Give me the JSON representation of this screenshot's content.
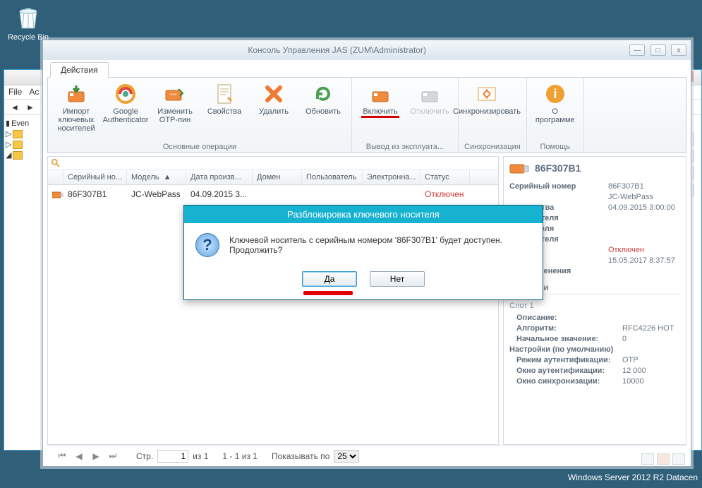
{
  "desktop": {
    "recycle_bin": "Recycle Bin"
  },
  "back_window": {
    "menu": [
      "File",
      "Ac"
    ],
    "tree_root": "Even",
    "close_x": "x"
  },
  "jas": {
    "title": "Консоль Управления JAS (ZUM\\Administrator)",
    "win_buttons": {
      "min": "—",
      "max": "□",
      "close": "x"
    },
    "tab": "Действия",
    "ribbon": {
      "groups": [
        {
          "label": "Основные операции",
          "items": [
            {
              "id": "import",
              "label": "Импорт ключевых\nносителей"
            },
            {
              "id": "gauth",
              "label": "Google\nAuthenticator"
            },
            {
              "id": "otp",
              "label": "Изменить\nOTP-пин"
            },
            {
              "id": "props",
              "label": "Свойства"
            },
            {
              "id": "delete",
              "label": "Удалить"
            },
            {
              "id": "refresh",
              "label": "Обновить"
            }
          ]
        },
        {
          "label": "Вывод из эксплуата...",
          "items": [
            {
              "id": "enable",
              "label": "Включить",
              "underline": true
            },
            {
              "id": "disable",
              "label": "Отключить",
              "disabled": true
            }
          ]
        },
        {
          "label": "Синхронизация",
          "items": [
            {
              "id": "sync",
              "label": "Синхронизировать"
            }
          ]
        },
        {
          "label": "Помощь",
          "items": [
            {
              "id": "about",
              "label": "О программе"
            }
          ]
        }
      ]
    },
    "table": {
      "columns": [
        "Серийный но...",
        "Модель",
        "Дата произв...",
        "Домен",
        "Пользователь",
        "Электронна...",
        "Статус"
      ],
      "widths": [
        90,
        84,
        94,
        70,
        86,
        82,
        70
      ],
      "icon_col_width": 22,
      "rows": [
        {
          "serial": "86F307B1",
          "model": "JC-WebPass",
          "date": "04.09.2015 3...",
          "domain": "",
          "user": "",
          "email": "",
          "status": "Отключен"
        }
      ]
    },
    "pager": {
      "page_label": "Стр.",
      "page_value": "1",
      "of": "из 1",
      "range": "1 - 1 из 1",
      "show_label": "Показывать по",
      "show_value": "25"
    },
    "details": {
      "device_name": "86F307B1",
      "props": [
        {
          "k": "Серийный номер",
          "v": "86F307B1"
        },
        {
          "k": "",
          "v": "JC-WebPass"
        },
        {
          "k": "оизводства",
          "v": "04.09.2015 3:00:00"
        },
        {
          "k": "ользователя",
          "v": ""
        },
        {
          "k": "льзователя",
          "v": ""
        },
        {
          "k": "ользователя",
          "v": ""
        },
        {
          "k": "",
          "v": "Отключен",
          "off": true
        },
        {
          "k": "здания",
          "v": "15.05.2017 8:37:57"
        },
        {
          "k": "Дата изменения",
          "v": ""
        }
      ],
      "counters_title": "Счетчики",
      "slot_title": "Слот 1",
      "slot": [
        {
          "k": "Описание:",
          "v": ""
        },
        {
          "k": "Алгоритм:",
          "v": "RFC4226 HOT"
        },
        {
          "k": "Начальное значение:",
          "v": "0"
        }
      ],
      "settings_title": "Настройки (по умолчанию)",
      "settings": [
        {
          "k": "Режим аутентификации:",
          "v": "OTP"
        },
        {
          "k": "Окно аутентификации:",
          "v": "12 000"
        },
        {
          "k": "Окно синхронизации:",
          "v": "10000"
        }
      ]
    }
  },
  "dialog": {
    "title": "Разблокировка ключевого носителя",
    "message": "Ключевой носитель с серийным номером '86F307B1' будет доступен. Продолжить?",
    "yes": "Да",
    "no": "Нет"
  },
  "os": {
    "watermark": "Windows Server 2012 R2 Datacen"
  }
}
